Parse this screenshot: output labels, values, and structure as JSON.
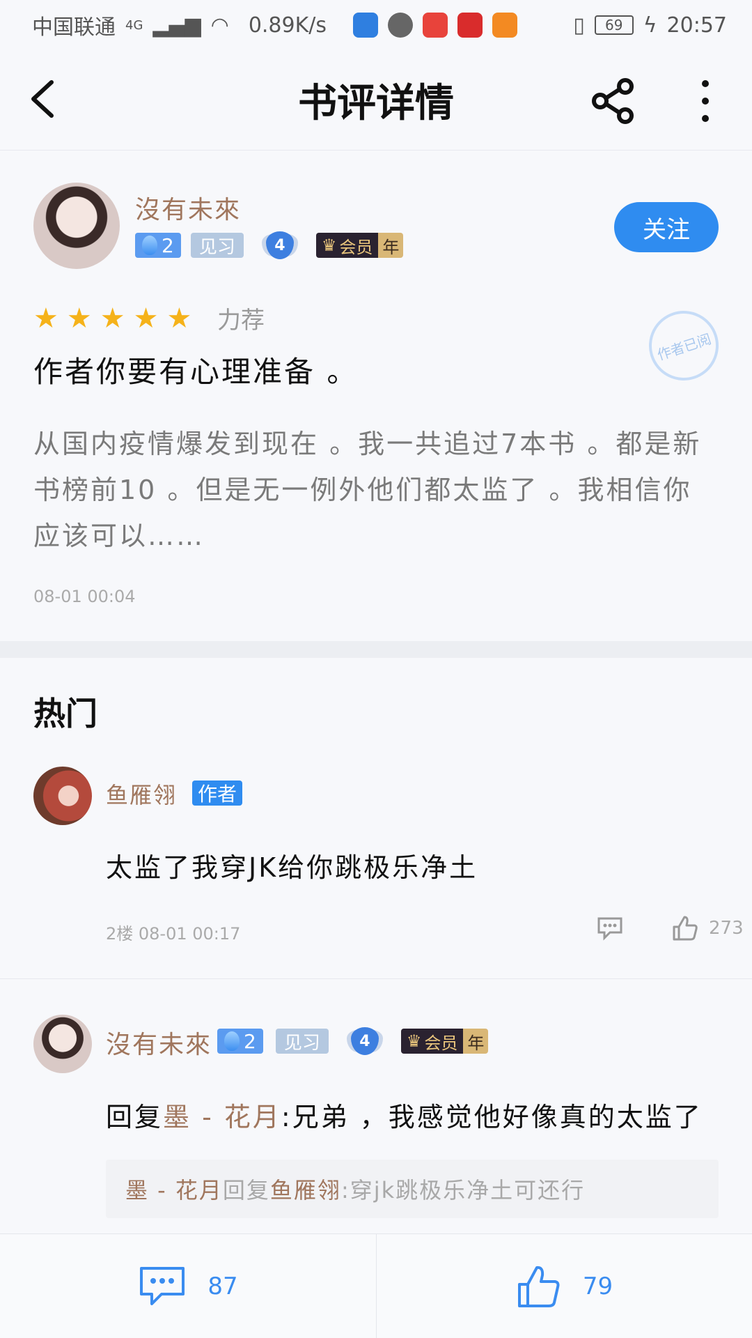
{
  "status_bar": {
    "carrier": "中国联通",
    "network": "4G",
    "speed": "0.89K/s",
    "battery": "69",
    "time": "20:57"
  },
  "app_bar": {
    "title": "书评详情"
  },
  "review": {
    "author": {
      "name": "沒有未來",
      "level": "2",
      "rank_tag": "见习",
      "shield_level": "4",
      "vip_label": "会员",
      "vip_period": "年"
    },
    "follow_label": "关注",
    "rating_stars": 5,
    "rating_label": "力荐",
    "stamp_text": "作者已阅",
    "title": "作者你要有心理准备 。",
    "body": "从国内疫情爆发到现在 。我一共追过7本书 。都是新书榜前10 。但是无一例外他们都太监了 。我相信你应该可以……",
    "time": "08-01 00:04"
  },
  "hot": {
    "heading": "热门",
    "comments": [
      {
        "name": "鱼雁翎",
        "author_tag": "作者",
        "text": "太监了我穿JK给你跳极乐净土",
        "meta": "2楼 08-01 00:17",
        "likes": "273"
      },
      {
        "name": "沒有未來",
        "level": "2",
        "rank_tag": "见习",
        "shield_level": "4",
        "vip_label": "会员",
        "vip_period": "年",
        "reply_prefix": "回复",
        "reply_to": "墨 - 花月",
        "reply_text": ":兄弟 ，我感觉他好像真的太监了",
        "quote_from": "墨 - 花月",
        "quote_mid": "回复",
        "quote_to": "鱼雁翎",
        "quote_text": ":穿jk跳极乐净土可还行"
      }
    ]
  },
  "bottom_bar": {
    "comments_count": "87",
    "likes_count": "79"
  },
  "colors": {
    "accent": "#2f8cf0",
    "username": "#a0765d",
    "star": "#f5b21a"
  }
}
